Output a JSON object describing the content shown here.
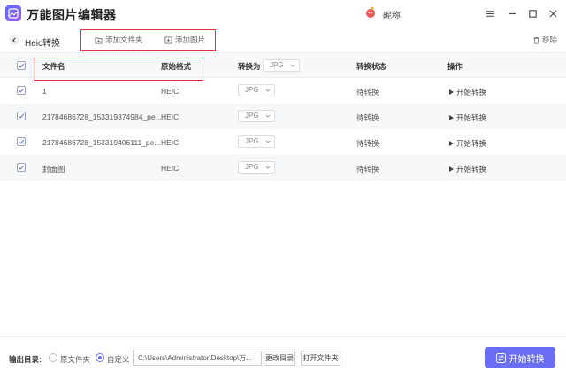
{
  "app": {
    "title": "万能图片编辑器",
    "user_name": "昵称"
  },
  "toolbar": {
    "page_title": "Heic转换",
    "add_folder": "添加文件夹",
    "add_image": "添加图片",
    "remove": "移除"
  },
  "table": {
    "headers": {
      "filename": "文件名",
      "format": "原始格式",
      "convert_to": "转换为",
      "convert_to_value": "JPG",
      "status": "转换状态",
      "action": "操作"
    },
    "rows": [
      {
        "checked": true,
        "filename": "1",
        "format": "HEIC",
        "target": "JPG",
        "status": "待转换",
        "action": "开始转换"
      },
      {
        "checked": true,
        "filename": "21784686728_153319374984_pe...",
        "format": "HEIC",
        "target": "JPG",
        "status": "待转换",
        "action": "开始转换"
      },
      {
        "checked": true,
        "filename": "21784686728_153319406111_pe...",
        "format": "HEIC",
        "target": "JPG",
        "status": "待转换",
        "action": "开始转换"
      },
      {
        "checked": true,
        "filename": "封面图",
        "format": "HEIC",
        "target": "JPG",
        "status": "待转换",
        "action": "开始转换"
      }
    ]
  },
  "bottom": {
    "output_label": "输出目录:",
    "option_original": "原文件夹",
    "option_custom": "自定义",
    "selected_option": "自定义",
    "path": "C:\\Users\\Administrator\\Desktop\\万...",
    "change_dir": "更改目录",
    "open_folder": "打开文件夹",
    "start": "开始转换"
  },
  "colors": {
    "accent": "#6b6ef5",
    "highlight_box": "#d9363e"
  }
}
